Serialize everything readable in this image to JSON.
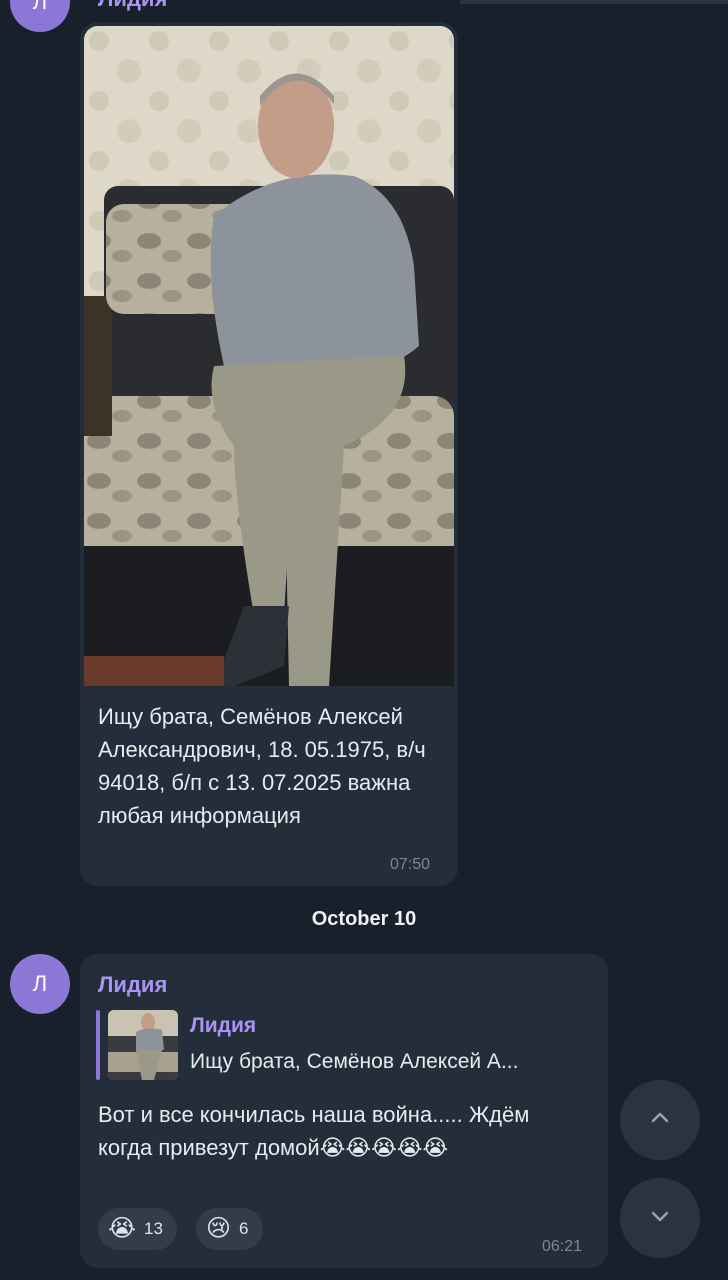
{
  "messages": [
    {
      "sender": "Лидия",
      "avatar_initial": "Л",
      "caption": "Ищу брата, Семёнов Алексей Александрович, 18. 05.1975, в/ч 94018, б/п с 13. 07.2025 важна любая информация",
      "time": "07:50"
    },
    {
      "sender": "Лидия",
      "avatar_initial": "Л",
      "reply": {
        "sender": "Лидия",
        "text": "Ищу брата, Семёнов Алексей А..."
      },
      "text": "Вот и все кончилась наша война..... Ждём когда привезут домой😭😭😭😭😭",
      "time": "06:21",
      "reactions": [
        {
          "emoji": "😭",
          "count": "13"
        },
        {
          "emoji": "😢",
          "count": "6"
        }
      ]
    }
  ],
  "date_separator": "October 10",
  "scroll_buttons": {
    "up_icon": "chevron-up-icon",
    "down_icon": "chevron-down-icon"
  },
  "colors": {
    "background": "#18202b",
    "bubble": "#242d3a",
    "accent": "#a894f2",
    "avatar": "#8a77d6"
  }
}
